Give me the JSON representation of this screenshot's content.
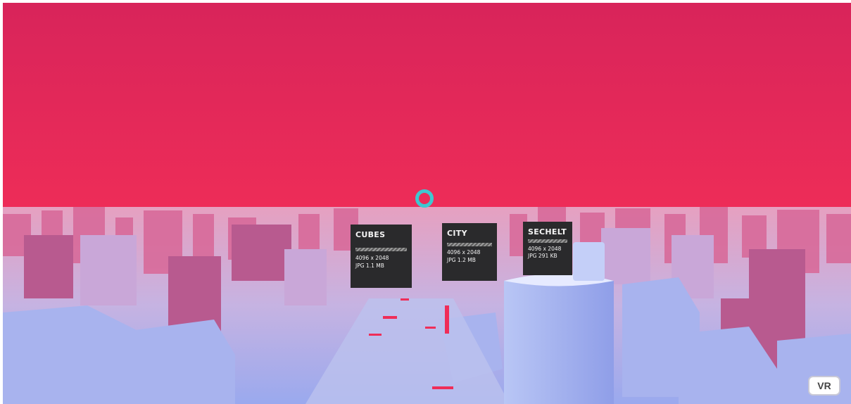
{
  "scene": {
    "sky_color": "#e4275a",
    "sky_top_color": "#d8245a",
    "city_tint": "#9aa6e8",
    "reticle_color": "#3fc7d0"
  },
  "cards": [
    {
      "title": "CUBES",
      "resolution": "4096 x 2048",
      "format": "JPG 1.1 MB"
    },
    {
      "title": "CITY",
      "resolution": "4096 x 2048",
      "format": "JPG 1.2 MB"
    },
    {
      "title": "SECHELT",
      "resolution": "4096 x 2048",
      "format": "JPG 291 KB"
    }
  ],
  "controls": {
    "vr_label": "VR"
  }
}
